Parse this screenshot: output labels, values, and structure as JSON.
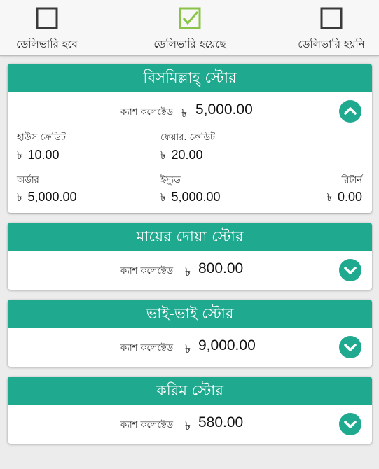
{
  "tabs": [
    {
      "label": "ডেলিভারি হবে",
      "checked": false
    },
    {
      "label": "ডেলিভারি হয়েছে",
      "checked": true
    },
    {
      "label": "ডেলিভারি হয়নি",
      "checked": false
    }
  ],
  "colors": {
    "accent": "#1fa98e",
    "check_accent": "#8bc34a"
  },
  "currency": "৳",
  "stores": [
    {
      "name": "বিসমিল্লাহ্ স্টোর",
      "cash_label": "ক্যাশ কলেক্টেড",
      "cash_value": "5,000.00",
      "expanded": true,
      "house_credit_label": "হাউস ক্রেডিট",
      "house_credit_value": "10.00",
      "fair_credit_label": "ফেয়ার. ক্রেডিট",
      "fair_credit_value": "20.00",
      "order_label": "অর্ডার",
      "order_value": "5,000.00",
      "issued_label": "ইস্যুড",
      "issued_value": "5,000.00",
      "return_label": "রিটার্ন",
      "return_value": "0.00"
    },
    {
      "name": "মায়ের দোয়া স্টোর",
      "cash_label": "ক্যাশ কলেক্টেড",
      "cash_value": "800.00",
      "expanded": false
    },
    {
      "name": "ভাই-ভাই স্টোর",
      "cash_label": "ক্যাশ কলেক্টেড",
      "cash_value": "9,000.00",
      "expanded": false
    },
    {
      "name": "করিম স্টোর",
      "cash_label": "ক্যাশ কলেক্টেড",
      "cash_value": "580.00",
      "expanded": false
    }
  ]
}
